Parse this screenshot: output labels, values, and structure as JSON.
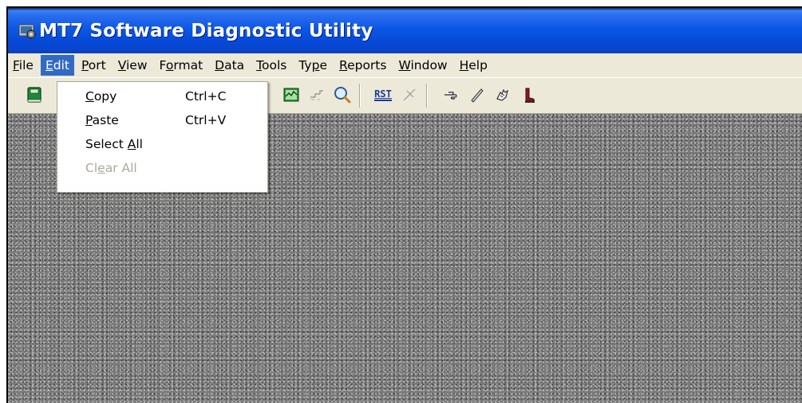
{
  "window": {
    "title": "MT7 Software Diagnostic Utility"
  },
  "menubar": {
    "items": [
      {
        "pre": "",
        "key": "F",
        "post": "ile"
      },
      {
        "pre": "",
        "key": "E",
        "post": "dit"
      },
      {
        "pre": "",
        "key": "P",
        "post": "ort"
      },
      {
        "pre": "",
        "key": "V",
        "post": "iew"
      },
      {
        "pre": "F",
        "key": "o",
        "post": "rmat"
      },
      {
        "pre": "",
        "key": "D",
        "post": "ata"
      },
      {
        "pre": "",
        "key": "T",
        "post": "ools"
      },
      {
        "pre": "Ty",
        "key": "p",
        "post": "e"
      },
      {
        "pre": "",
        "key": "R",
        "post": "eports"
      },
      {
        "pre": "",
        "key": "W",
        "post": "indow"
      },
      {
        "pre": "",
        "key": "H",
        "post": "elp"
      }
    ]
  },
  "toolbar": {
    "rst_label": "RST"
  },
  "edit_menu": {
    "items": [
      {
        "pre": "",
        "key": "C",
        "post": "opy",
        "shortcut": "Ctrl+C",
        "enabled": true
      },
      {
        "pre": "",
        "key": "P",
        "post": "aste",
        "shortcut": "Ctrl+V",
        "enabled": true
      },
      {
        "pre": "Select ",
        "key": "A",
        "post": "ll",
        "shortcut": "",
        "enabled": true
      },
      {
        "pre": "Cl",
        "key": "e",
        "post": "ar All",
        "shortcut": "",
        "enabled": false
      }
    ]
  },
  "colors": {
    "title_bar": "#0548d8",
    "menu_highlight": "#316ac5",
    "disabled_text": "#aca899"
  }
}
